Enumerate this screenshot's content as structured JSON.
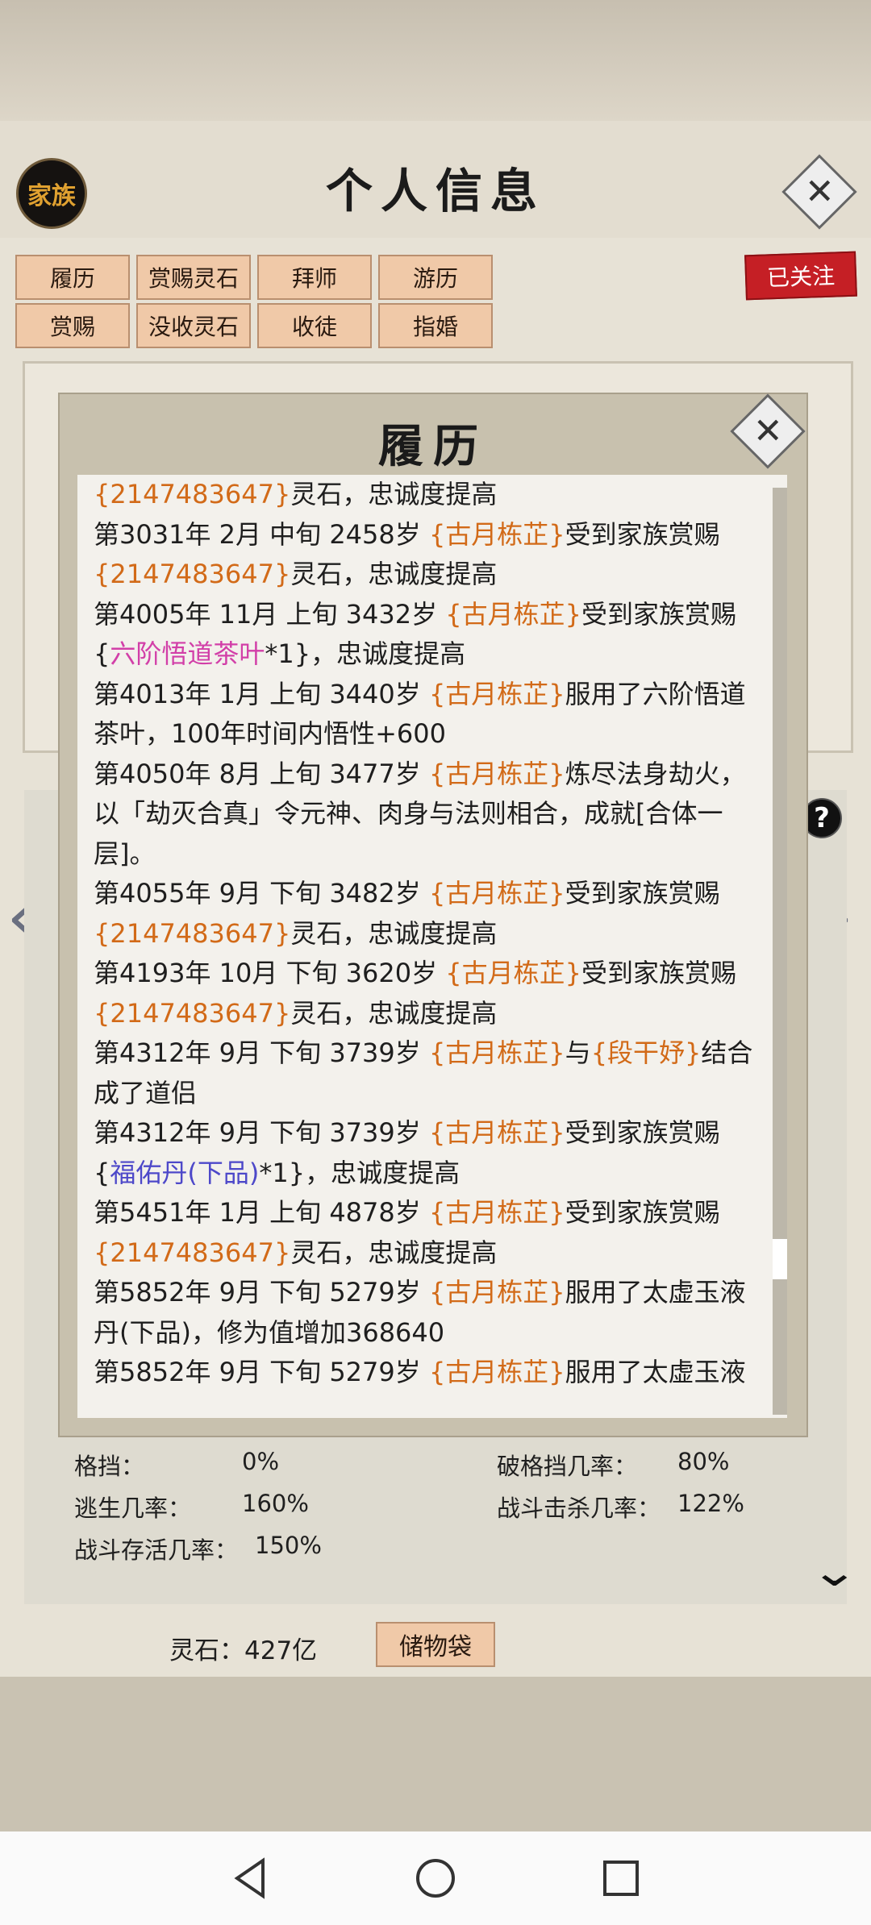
{
  "header": {
    "clan_button": "家族",
    "title": "个人信息"
  },
  "tabs": [
    {
      "label": "履历"
    },
    {
      "label": "赏赐灵石"
    },
    {
      "label": "拜师"
    },
    {
      "label": "游历"
    },
    {
      "label": "赏赐"
    },
    {
      "label": "没收灵石"
    },
    {
      "label": "收徒"
    },
    {
      "label": "指婚"
    }
  ],
  "follow_badge": "已关注",
  "dialog": {
    "title": "履历",
    "log_lines": [
      [
        {
          "t": "{2147483647}",
          "c": "o"
        },
        {
          "t": "灵石，忠诚度提高"
        }
      ],
      [
        {
          "t": "第3031年 2月 中旬  2458岁 "
        },
        {
          "t": "{古月栋芷}",
          "c": "o"
        },
        {
          "t": "受到家族赏赐"
        }
      ],
      [
        {
          "t": "{2147483647}",
          "c": "o"
        },
        {
          "t": "灵石，忠诚度提高"
        }
      ],
      [
        {
          "t": "第4005年 11月 上旬  3432岁 "
        },
        {
          "t": "{古月栋芷}",
          "c": "o"
        },
        {
          "t": "受到家族赏赐"
        }
      ],
      [
        {
          "t": "{"
        },
        {
          "t": "六阶悟道茶叶",
          "c": "m"
        },
        {
          "t": "*1}，忠诚度提高"
        }
      ],
      [
        {
          "t": "第4013年 1月 上旬  3440岁 "
        },
        {
          "t": "{古月栋芷}",
          "c": "o"
        },
        {
          "t": "服用了六阶悟道"
        }
      ],
      [
        {
          "t": "茶叶，100年时间内悟性+600"
        }
      ],
      [
        {
          "t": "第4050年 8月 上旬  3477岁 "
        },
        {
          "t": "{古月栋芷}",
          "c": "o"
        },
        {
          "t": "炼尽法身劫火，"
        }
      ],
      [
        {
          "t": "以「劫灭合真」令元神、肉身与法则相合，成就[合体一"
        }
      ],
      [
        {
          "t": "层]。"
        }
      ],
      [
        {
          "t": "第4055年 9月 下旬  3482岁 "
        },
        {
          "t": "{古月栋芷}",
          "c": "o"
        },
        {
          "t": "受到家族赏赐"
        }
      ],
      [
        {
          "t": "{2147483647}",
          "c": "o"
        },
        {
          "t": "灵石，忠诚度提高"
        }
      ],
      [
        {
          "t": "第4193年 10月 下旬  3620岁 "
        },
        {
          "t": "{古月栋芷}",
          "c": "o"
        },
        {
          "t": "受到家族赏赐"
        }
      ],
      [
        {
          "t": "{2147483647}",
          "c": "o"
        },
        {
          "t": "灵石，忠诚度提高"
        }
      ],
      [
        {
          "t": "第4312年 9月 下旬  3739岁 "
        },
        {
          "t": "{古月栋芷}",
          "c": "o"
        },
        {
          "t": "与"
        },
        {
          "t": "{段干妤}",
          "c": "o"
        },
        {
          "t": "结合"
        }
      ],
      [
        {
          "t": "成了道侣"
        }
      ],
      [
        {
          "t": "第4312年 9月 下旬  3739岁 "
        },
        {
          "t": "{古月栋芷}",
          "c": "o"
        },
        {
          "t": "受到家族赏赐"
        }
      ],
      [
        {
          "t": "{"
        },
        {
          "t": "福佑丹(下品)",
          "c": "b"
        },
        {
          "t": "*1}，忠诚度提高"
        }
      ],
      [
        {
          "t": "第5451年 1月 上旬  4878岁 "
        },
        {
          "t": "{古月栋芷}",
          "c": "o"
        },
        {
          "t": "受到家族赏赐"
        }
      ],
      [
        {
          "t": "{2147483647}",
          "c": "o"
        },
        {
          "t": "灵石，忠诚度提高"
        }
      ],
      [
        {
          "t": "第5852年 9月 下旬 5279岁 "
        },
        {
          "t": "{古月栋芷}",
          "c": "o"
        },
        {
          "t": "服用了太虚玉液"
        }
      ],
      [
        {
          "t": "丹(下品)，修为值增加368640"
        }
      ],
      [
        {
          "t": "第5852年 9月 下旬 5279岁 "
        },
        {
          "t": "{古月栋芷}",
          "c": "o"
        },
        {
          "t": "服用了太虚玉液"
        }
      ]
    ]
  },
  "stats": {
    "block_label": "格挡：",
    "block_value": "0%",
    "break_block_label": "破格挡几率：",
    "break_block_value": "80%",
    "escape_label": "逃生几率：",
    "escape_value": "160%",
    "kill_label": "战斗击杀几率：",
    "kill_value": "122%",
    "survive_label": "战斗存活几率：",
    "survive_value": "150%"
  },
  "footer": {
    "spirit_stone": "灵石：427亿",
    "bag_button": "储物袋"
  },
  "colors": {
    "orange": "#d26a18",
    "magenta": "#d23fa8",
    "blue": "#4d48c9",
    "follow_red": "#c51f25"
  }
}
